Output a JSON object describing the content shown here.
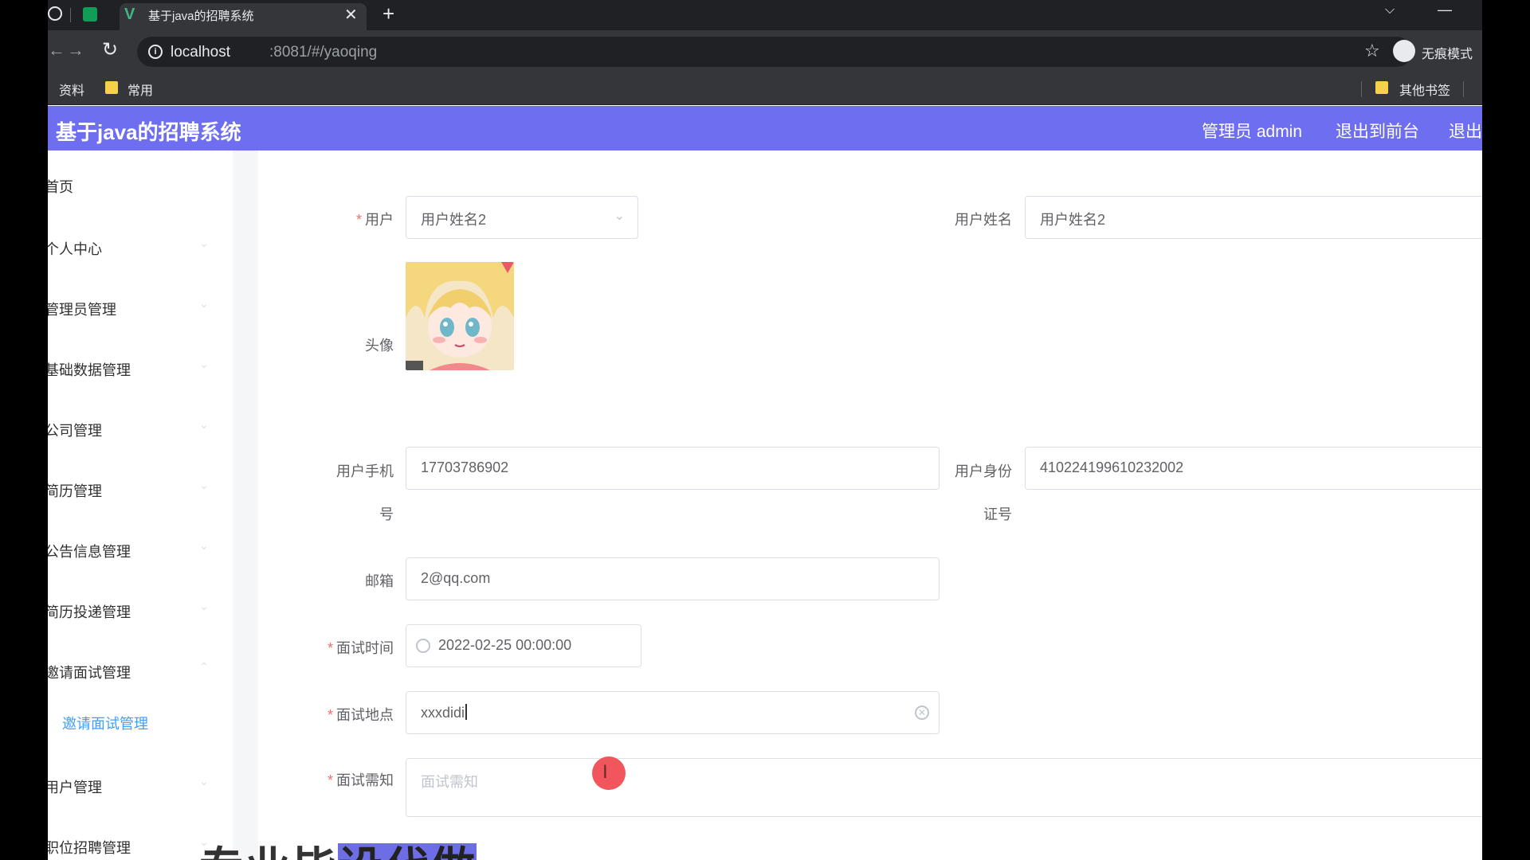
{
  "browser": {
    "tab_title": "基于java的招聘系统",
    "tab_close": "✕",
    "tab_new": "+",
    "url_host": "localhost",
    "url_rest": ":8081/#/yaoqing",
    "incognito_label": "无痕模式",
    "bookmarks": [
      "资料",
      "常用"
    ],
    "other_bookmarks": "其他书签"
  },
  "header": {
    "title": "基于java的招聘系统",
    "admin_label": "管理员 admin",
    "front_link": "退出到前台",
    "logout_link": "退出"
  },
  "sidebar": {
    "items": [
      "首页",
      "个人中心",
      "管理员管理",
      "基础数据管理",
      "公司管理",
      "简历管理",
      "公告信息管理",
      "简历投递管理",
      "邀请面试管理",
      "用户管理",
      "职位招聘管理"
    ],
    "sub_item": "邀请面试管理"
  },
  "form": {
    "user_label": "用户",
    "user_value": "用户姓名2",
    "username_label": "用户姓名",
    "username_value": "用户姓名2",
    "avatar_label": "头像",
    "phone_label_1": "用户手机",
    "phone_label_2": "号",
    "phone_value": "17703786902",
    "idcard_label_1": "用户身份",
    "idcard_label_2": "证号",
    "idcard_value": "410224199610232002",
    "email_label": "邮箱",
    "email_value": "2@qq.com",
    "time_label": "面试时间",
    "time_value": "2022-02-25 00:00:00",
    "place_label": "面试地点",
    "place_value": "xxxdidi",
    "notice_label": "面试需知",
    "notice_placeholder": "面试需知"
  },
  "overlay": {
    "text_plain": "专业毕",
    "text_highlight": "设代做"
  },
  "colors": {
    "header_bg": "#6e6ff0",
    "accent": "#409eff",
    "required": "#f56c6c"
  }
}
